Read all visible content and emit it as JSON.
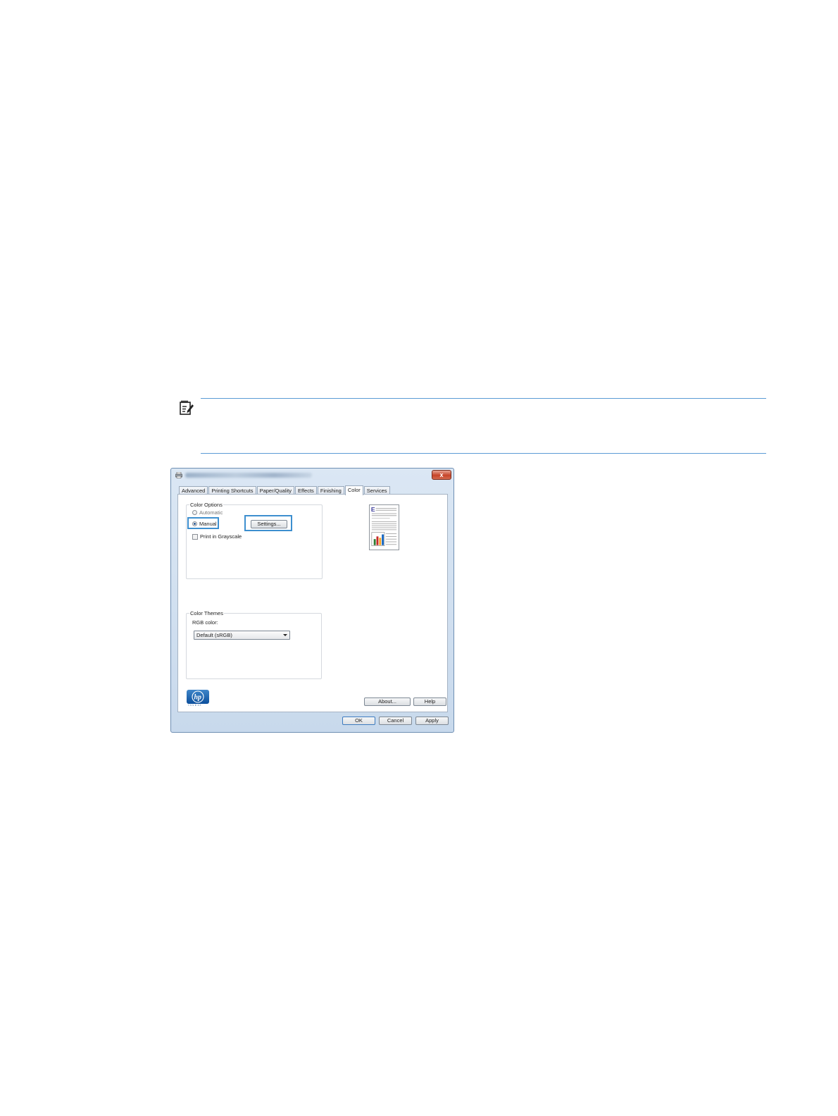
{
  "dialog": {
    "tabs": [
      {
        "label": "Advanced"
      },
      {
        "label": "Printing Shortcuts"
      },
      {
        "label": "Paper/Quality"
      },
      {
        "label": "Effects"
      },
      {
        "label": "Finishing"
      },
      {
        "label": "Color"
      },
      {
        "label": "Services"
      }
    ],
    "active_tab": "Color",
    "color_options": {
      "group_label": "Color Options",
      "automatic_label": "Automatic",
      "manual_label": "Manual",
      "selected": "Manual",
      "settings_button": "Settings...",
      "grayscale_label": "Print in Grayscale",
      "grayscale_checked": false
    },
    "color_themes": {
      "group_label": "Color Themes",
      "rgb_label": "RGB color:",
      "rgb_value": "Default (sRGB)"
    },
    "about_button": "About...",
    "help_button": "Help",
    "ok_button": "OK",
    "cancel_button": "Cancel",
    "apply_button": "Apply",
    "close_glyph": "x",
    "logo": {
      "text": "hp",
      "tagline": "invent"
    }
  },
  "colors": {
    "highlight": "#3d8fcf",
    "note_rule": "#5b9bd5",
    "hp_blue": "#0b4f9c"
  }
}
